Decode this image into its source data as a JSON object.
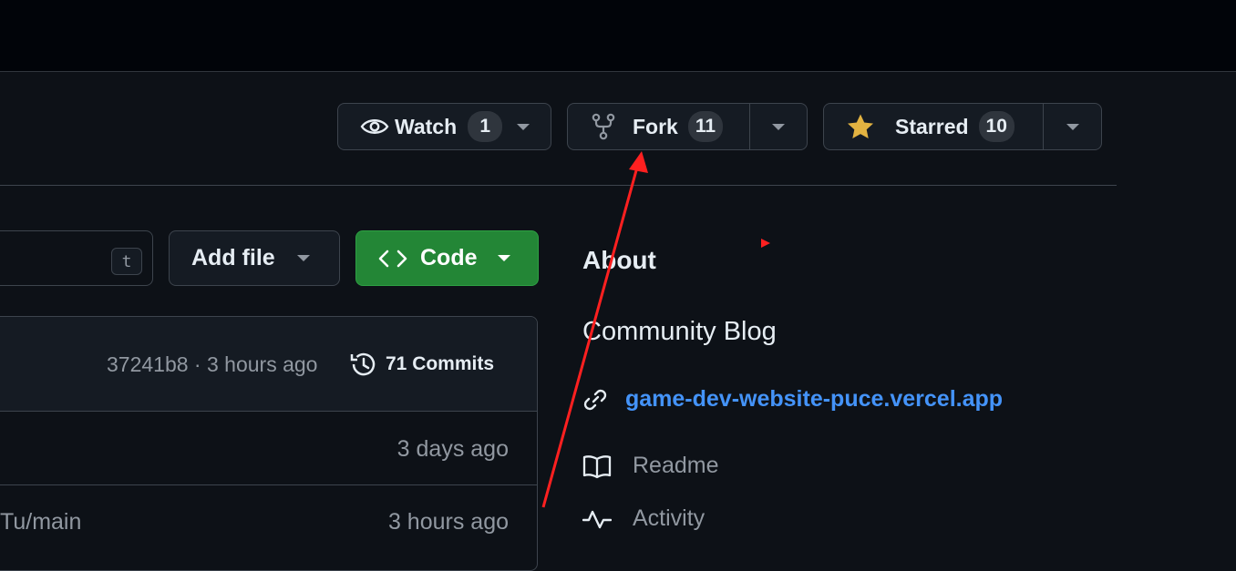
{
  "repo_actions": {
    "watch": {
      "label": "Watch",
      "count": "1"
    },
    "fork": {
      "label": "Fork",
      "count": "11"
    },
    "star": {
      "label": "Starred",
      "count": "10"
    }
  },
  "file_bar": {
    "search_shortcut": "t",
    "add_file_label": "Add file",
    "code_label": "Code"
  },
  "latest_commit": {
    "hash_time": "37241b8 · 3 hours ago",
    "commits_label": "71 Commits"
  },
  "file_rows": [
    {
      "name": "",
      "time": "3 days ago"
    },
    {
      "name": "Tu/main",
      "time": "3 hours ago"
    }
  ],
  "about": {
    "heading": "About",
    "description": "Community Blog",
    "link": "game-dev-website-puce.vercel.app",
    "items": [
      "Readme",
      "Activity"
    ]
  },
  "colors": {
    "background": "#0d1117",
    "topbar": "#010409",
    "code_button": "#238636",
    "link": "#4493f8",
    "star": "#e3b341",
    "annotation_arrow": "#ff2020"
  }
}
